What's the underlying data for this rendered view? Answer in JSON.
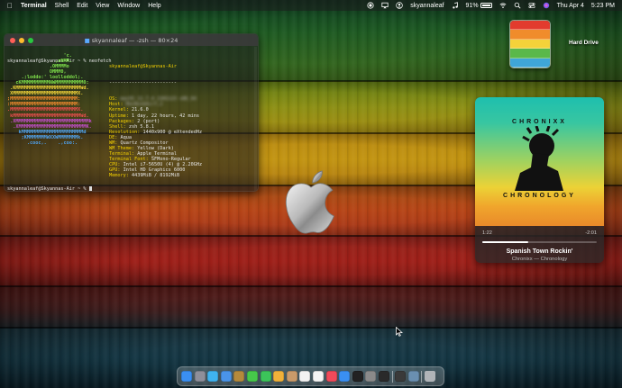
{
  "menubar": {
    "app_name": "Terminal",
    "menus": [
      "Shell",
      "Edit",
      "View",
      "Window",
      "Help"
    ],
    "user": "skyannaleaf",
    "battery_percent": "91%",
    "datetime_day": "Thu Apr 4",
    "datetime_time": "5:23 PM"
  },
  "terminal": {
    "title": "skyannaleaf — -zsh — 80×24",
    "first_prompt": "skyannaleaf@Skyannas-Air ~ % neofetch",
    "user_host": "skyannaleaf@Skyannas-Air",
    "separator": "------------------------",
    "info": [
      {
        "label": "OS: ",
        "value": "macOS 12.7.4 21H1123 x86_64",
        "blurred": true
      },
      {
        "label": "Host: ",
        "value": "MacBookAir7,2",
        "blurred": true
      },
      {
        "label": "Kernel: ",
        "value": "21.6.0",
        "blurred": false
      },
      {
        "label": "Uptime: ",
        "value": "1 day, 22 hours, 42 mins",
        "blurred": false
      },
      {
        "label": "Packages: ",
        "value": "2 (port)",
        "blurred": false
      },
      {
        "label": "Shell: ",
        "value": "zsh 5.8.1",
        "blurred": false
      },
      {
        "label": "Resolution: ",
        "value": "1440x900 @ eXtendedHz",
        "blurred": false
      },
      {
        "label": "DE: ",
        "value": "Aqua",
        "blurred": false
      },
      {
        "label": "WM: ",
        "value": "Quartz Compositor",
        "blurred": false
      },
      {
        "label": "WM Theme: ",
        "value": "Yellow (Dark)",
        "blurred": false
      },
      {
        "label": "Terminal: ",
        "value": "Apple_Terminal",
        "blurred": false
      },
      {
        "label": "Terminal Font: ",
        "value": "SFMono-Regular",
        "blurred": false
      },
      {
        "label": "CPU: ",
        "value": "Intel i7-5650U (4) @ 2.20GHz",
        "blurred": false
      },
      {
        "label": "GPU: ",
        "value": "Intel HD Graphics 6000",
        "blurred": false
      },
      {
        "label": "Memory: ",
        "value": "4439MiB / 8192MiB",
        "blurred": false
      }
    ],
    "logo_lines": [
      "                    'c.",
      "                 ,xNMM.",
      "               .OMMMMo",
      "               OMMM0,",
      "     .;loddo:' loolloddol;.",
      "   cKMMMMMMMMMMNWMMMMMMMMMM0:",
      " .KMMMMMMMMMMMMMMMMMMMMMMMWd.",
      " XMMMMMMMMMMMMMMMMMMMMMMMX.",
      ";MMMMMMMMMMMMMMMMMMMMMMMM:",
      ":MMMMMMMMMMMMMMMMMMMMMMMM:",
      ".MMMMMMMMMMMMMMMMMMMMMMMMX.",
      " kMMMMMMMMMMMMMMMMMMMMMMMMWd.",
      " .XMMMMMMMMMMMMMMMMMMMMMMMMMMk",
      "  .XMMMMMMMMMMMMMMMMMMMMMMMMK.",
      "    kMMMMMMMMMMMMMMMMMMMMMMd",
      "     ;KMMMMMMMWXXWMMMMMMMk.",
      "       .cooc,.    .,coo:."
    ],
    "logo_colors": [
      "#7ee04a",
      "#7ee04a",
      "#7ee04a",
      "#7ee04a",
      "#7ee04a",
      "#7ee04a",
      "#f2d43a",
      "#f2d43a",
      "#f08a2e",
      "#f08a2e",
      "#ea4e4e",
      "#ea4e4e",
      "#c64fd0",
      "#c64fd0",
      "#4fa3f0",
      "#4fa3f0",
      "#4fa3f0"
    ],
    "swatches": [
      "#3b3b3b",
      "#8a3a3a",
      "#5c8a3a",
      "#8a7a3a",
      "#3a4f8a",
      "#7a3a8a",
      "#3a7a8a",
      "#9a9a9a"
    ],
    "last_prompt": "skyannaleaf@Skyannas-Air ~ % "
  },
  "desktop": {
    "hard_drive_label": "Hard Drive",
    "hard_drive_colors": [
      "#e23b2e",
      "#f08c2b",
      "#f4d23a",
      "#5ab84a",
      "#3fa6d8"
    ]
  },
  "music": {
    "album_top_text": "CHRONIXX",
    "album_bottom_text": "CHRONOLOGY",
    "elapsed": "1:22",
    "remaining": "-2:01",
    "progress": 0.4,
    "song": "Spanish Town Rockin'",
    "artist_album": "Chronixx — Chronology"
  },
  "dock": {
    "items": [
      {
        "name": "finder-icon",
        "color": "#3a8ff2"
      },
      {
        "name": "launchpad-icon",
        "color": "#8f8f9a"
      },
      {
        "name": "safari-icon",
        "color": "#3fb3f0"
      },
      {
        "name": "mail-icon",
        "color": "#4a94e8"
      },
      {
        "name": "notes-icon",
        "color": "#b58a3c"
      },
      {
        "name": "messages-icon",
        "color": "#46c84a"
      },
      {
        "name": "facetime-icon",
        "color": "#3cc45a"
      },
      {
        "name": "photos-icon",
        "color": "#f0b13a"
      },
      {
        "name": "contacts-icon",
        "color": "#c99a6a"
      },
      {
        "name": "calendar-icon",
        "color": "#f2f2f2"
      },
      {
        "name": "reminders-icon",
        "color": "#f5f5f5"
      },
      {
        "name": "music-icon",
        "color": "#f04a5a"
      },
      {
        "name": "app-store-icon",
        "color": "#3a8ff2"
      },
      {
        "name": "tv-icon",
        "color": "#222222"
      },
      {
        "name": "settings-icon",
        "color": "#8a8a8a"
      },
      {
        "name": "terminal-icon",
        "color": "#2a2a2a"
      },
      {
        "name": "activity-monitor-icon",
        "color": "#3a3a3a"
      },
      {
        "name": "preview-icon",
        "color": "#6a8fb0"
      }
    ],
    "trash_color": "#b0b4b8"
  }
}
